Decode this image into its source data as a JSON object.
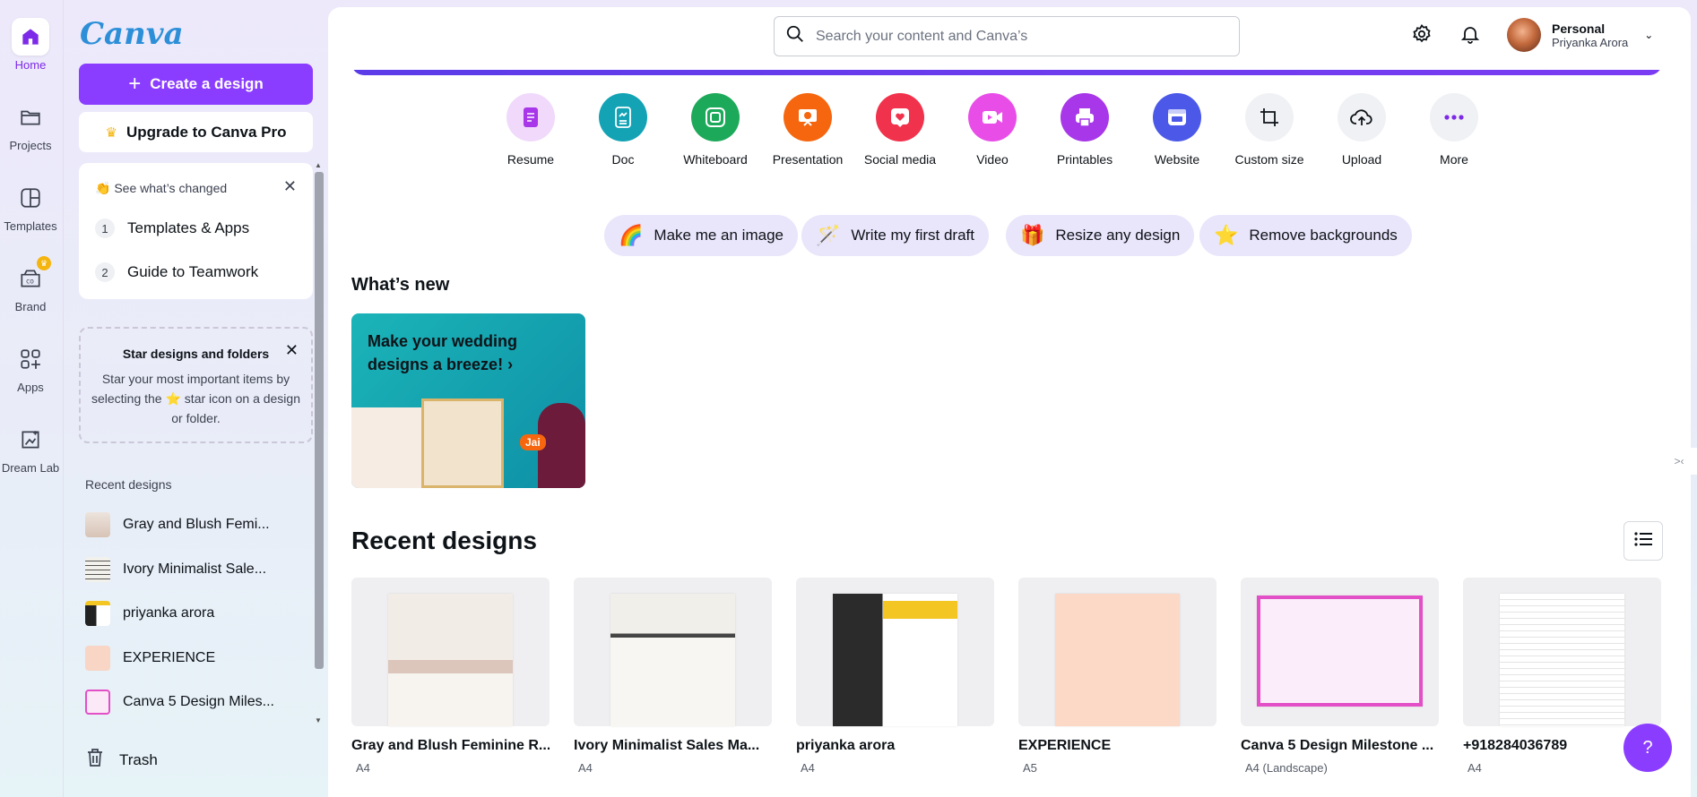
{
  "rail": {
    "items": [
      {
        "label": "Home",
        "icon": "home-icon"
      },
      {
        "label": "Projects",
        "icon": "folder-icon"
      },
      {
        "label": "Templates",
        "icon": "templates-icon"
      },
      {
        "label": "Brand",
        "icon": "brand-icon"
      },
      {
        "label": "Apps",
        "icon": "apps-icon"
      },
      {
        "label": "Dream Lab",
        "icon": "dream-lab-icon"
      }
    ]
  },
  "panel": {
    "logo": "Canva",
    "create_label": "Create a design",
    "upgrade_label": "Upgrade to Canva Pro",
    "changed": {
      "title": "👏 See what’s changed",
      "items": [
        {
          "num": "1",
          "label": "Templates & Apps"
        },
        {
          "num": "2",
          "label": "Guide to Teamwork"
        }
      ]
    },
    "star_tip": {
      "title": "Star designs and folders",
      "body": "Star your most important items by selecting the ⭐ star icon on a design or folder."
    },
    "recent_label": "Recent designs",
    "recent": [
      "Gray and Blush Femi...",
      "Ivory Minimalist Sale...",
      "priyanka arora",
      "EXPERIENCE",
      "Canva 5 Design Miles..."
    ],
    "trash_label": "Trash"
  },
  "header": {
    "search_placeholder": "Search your content and Canva’s",
    "account_type": "Personal",
    "account_name": "Priyanka Arora"
  },
  "design_types": [
    {
      "label": "Resume",
      "color": "#f0d9fb"
    },
    {
      "label": "Doc",
      "color": "#13a3b5"
    },
    {
      "label": "Whiteboard",
      "color": "#1da95a"
    },
    {
      "label": "Presentation",
      "color": "#f5660f"
    },
    {
      "label": "Social media",
      "color": "#f1324c"
    },
    {
      "label": "Video",
      "color": "#e84ee7"
    },
    {
      "label": "Printables",
      "color": "#a737e8"
    },
    {
      "label": "Website",
      "color": "#4b58e8"
    },
    {
      "label": "Custom size",
      "color": "#f0f1f4"
    },
    {
      "label": "Upload",
      "color": "#f0f1f4"
    },
    {
      "label": "More",
      "color": "#f0f1f4"
    }
  ],
  "quick_actions": [
    {
      "label": "Make me an image",
      "icon": "🌈"
    },
    {
      "label": "Write my first draft",
      "icon": "🪄"
    },
    {
      "label": "Resize any design",
      "icon": "🎁"
    },
    {
      "label": "Remove backgrounds",
      "icon": "⭐"
    }
  ],
  "whats_new": {
    "heading": "What’s new",
    "promo_title": "Make your wedding designs a breeze!",
    "promo_badge": "Jai"
  },
  "recent": {
    "heading": "Recent designs",
    "designs": [
      {
        "title": "Gray and Blush Feminine R...",
        "size": "A4"
      },
      {
        "title": "Ivory Minimalist Sales Ma...",
        "size": "A4"
      },
      {
        "title": "priyanka arora",
        "size": "A4"
      },
      {
        "title": "EXPERIENCE",
        "size": "A5"
      },
      {
        "title": "Canva 5 Design Milestone ...",
        "size": "A4 (Landscape)"
      },
      {
        "title": "+918284036789",
        "size": "A4"
      }
    ]
  },
  "help_label": "?"
}
